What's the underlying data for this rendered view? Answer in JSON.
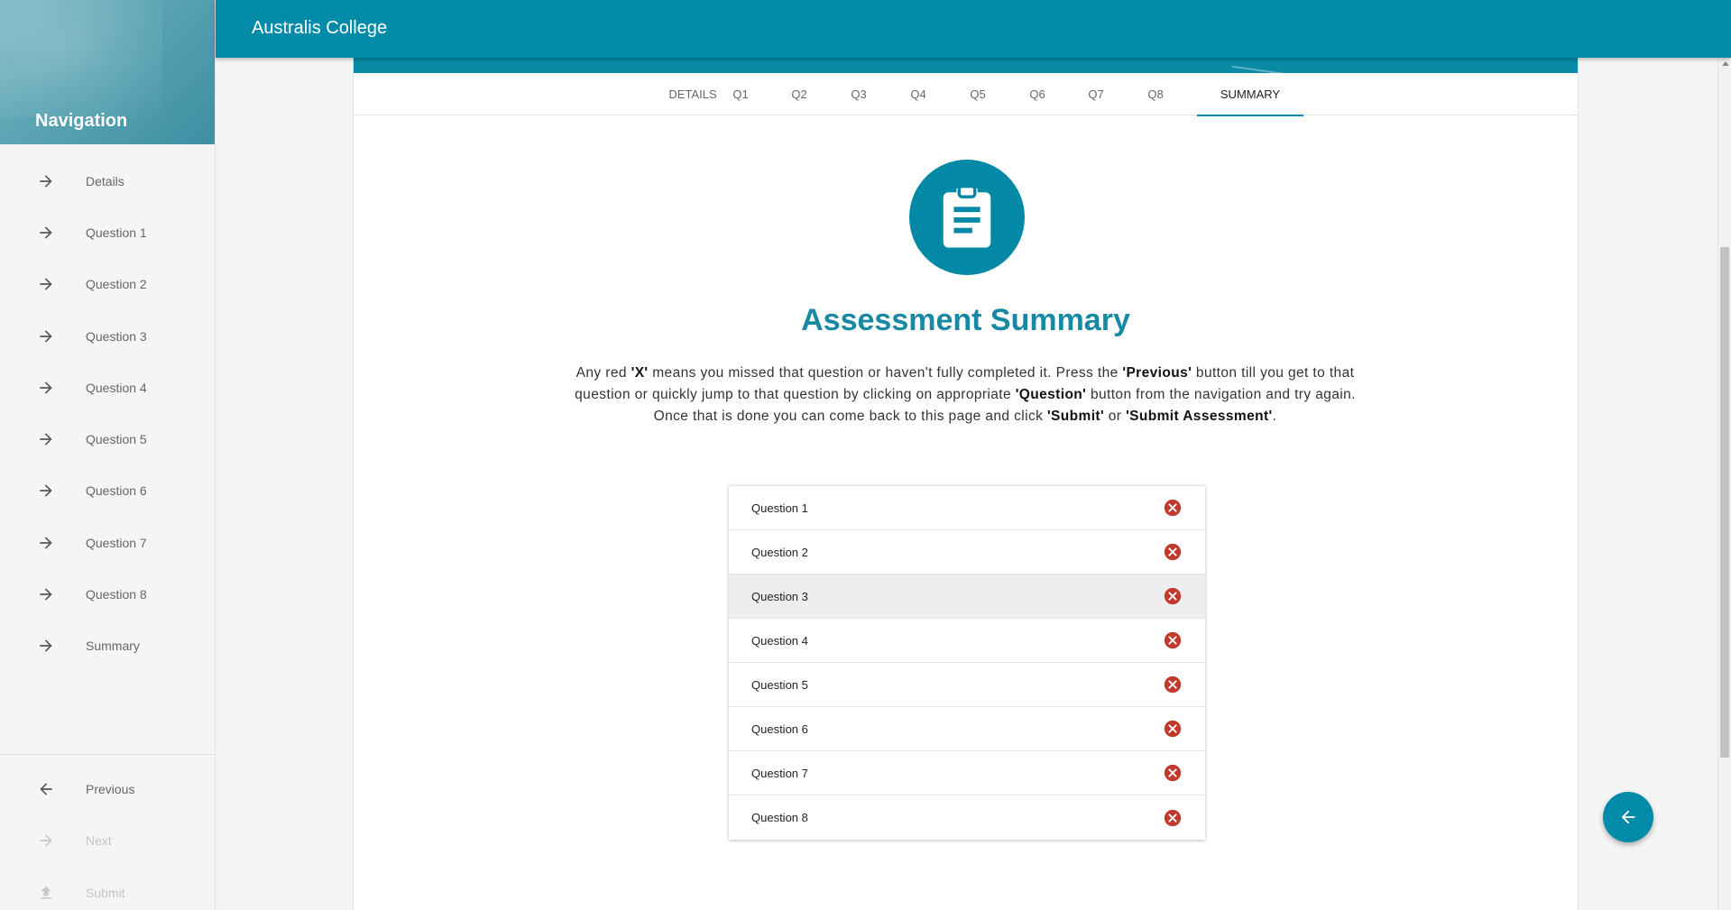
{
  "app": {
    "title": "Australis College"
  },
  "sidebar": {
    "title": "Navigation",
    "items": [
      {
        "label": "Details",
        "icon": "arrow-right-icon"
      },
      {
        "label": "Question 1",
        "icon": "arrow-right-icon"
      },
      {
        "label": "Question 2",
        "icon": "arrow-right-icon"
      },
      {
        "label": "Question 3",
        "icon": "arrow-right-icon"
      },
      {
        "label": "Question 4",
        "icon": "arrow-right-icon"
      },
      {
        "label": "Question 5",
        "icon": "arrow-right-icon"
      },
      {
        "label": "Question 6",
        "icon": "arrow-right-icon"
      },
      {
        "label": "Question 7",
        "icon": "arrow-right-icon"
      },
      {
        "label": "Question 8",
        "icon": "arrow-right-icon"
      },
      {
        "label": "Summary",
        "icon": "arrow-right-icon"
      }
    ],
    "bottom": [
      {
        "label": "Previous",
        "icon": "arrow-left-icon",
        "enabled": true
      },
      {
        "label": "Next",
        "icon": "arrow-right-icon",
        "enabled": false
      },
      {
        "label": "Submit",
        "icon": "upload-icon",
        "enabled": false
      }
    ]
  },
  "tabs": {
    "items": [
      "DETAILS",
      "Q1",
      "Q2",
      "Q3",
      "Q4",
      "Q5",
      "Q6",
      "Q7",
      "Q8",
      "SUMMARY"
    ],
    "active": "SUMMARY"
  },
  "summary": {
    "icon": "clipboard-icon",
    "title": "Assessment Summary",
    "text_1": "Any red ",
    "bold_1": "'X'",
    "text_2": " means you missed that question or haven't fully completed it. Press the ",
    "bold_2": "'Previous'",
    "text_3": " button till you get to that question or quickly jump to that question by clicking on appropriate ",
    "bold_3": "'Question'",
    "text_4": " button from the navigation and try again. Once that is done you can come back to this page and click ",
    "bold_4": "'Submit'",
    "text_5": " or ",
    "bold_5": "'Submit Assessment'",
    "text_6": "."
  },
  "questions": {
    "rows": [
      {
        "label": "Question 1",
        "status": "incomplete"
      },
      {
        "label": "Question 2",
        "status": "incomplete"
      },
      {
        "label": "Question 3",
        "status": "incomplete"
      },
      {
        "label": "Question 4",
        "status": "incomplete"
      },
      {
        "label": "Question 5",
        "status": "incomplete"
      },
      {
        "label": "Question 6",
        "status": "incomplete"
      },
      {
        "label": "Question 7",
        "status": "incomplete"
      },
      {
        "label": "Question 8",
        "status": "incomplete"
      }
    ],
    "status_icon": "x-circle-icon"
  },
  "fab": {
    "icon": "arrow-left-icon"
  },
  "colors": {
    "primary": "#028ba9",
    "title": "#1889a4",
    "error": "#c0392b"
  }
}
